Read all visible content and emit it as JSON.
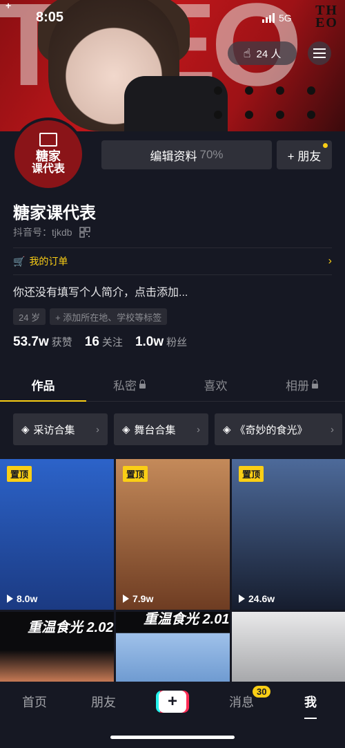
{
  "status": {
    "plus": "+",
    "time": "8:05",
    "network": "5G"
  },
  "banner": {
    "brand": "THEO",
    "brand_line1": "TH",
    "brand_line2": "EO",
    "letters": "THEO"
  },
  "header": {
    "visitors_label": "24 人"
  },
  "profile": {
    "avatar_text_top": "糖家",
    "avatar_text_bottom": "课代表",
    "edit_label": "编辑资料",
    "edit_percent": "70%",
    "friend_label": "+ 朋友",
    "name": "糖家课代表",
    "id_label": "抖音号：tjkdb",
    "orders_label": "我的订单",
    "bio": "你还没有填写个人简介，点击添加...",
    "tags": [
      "24 岁",
      "+ 添加所在地、学校等标签"
    ],
    "stats": [
      {
        "num": "53.7w",
        "label": "获赞"
      },
      {
        "num": "16",
        "label": "关注"
      },
      {
        "num": "1.0w",
        "label": "粉丝"
      }
    ]
  },
  "tabs": [
    {
      "label": "作品"
    },
    {
      "label": "私密"
    },
    {
      "label": "喜欢"
    },
    {
      "label": "相册"
    }
  ],
  "collections": [
    "采访合集",
    "舞台合集",
    "《奇妙的食光》"
  ],
  "videos": [
    {
      "pin": "置顶",
      "views": "8.0w",
      "color": "#1f4aa8"
    },
    {
      "pin": "置顶",
      "views": "7.9w",
      "color": "#9a5a36"
    },
    {
      "pin": "置顶",
      "views": "24.6w",
      "color": "#1e2b4a"
    },
    {
      "title": "重温食光 2.02",
      "color": "#0b0b0d"
    },
    {
      "title": "重温食光 2.01",
      "color": "#7fa7d8"
    },
    {
      "color": "#cfcfd0"
    }
  ],
  "nav": {
    "home": "首页",
    "friends": "朋友",
    "add": "+",
    "messages": "消息",
    "messages_badge": "30",
    "me": "我"
  }
}
